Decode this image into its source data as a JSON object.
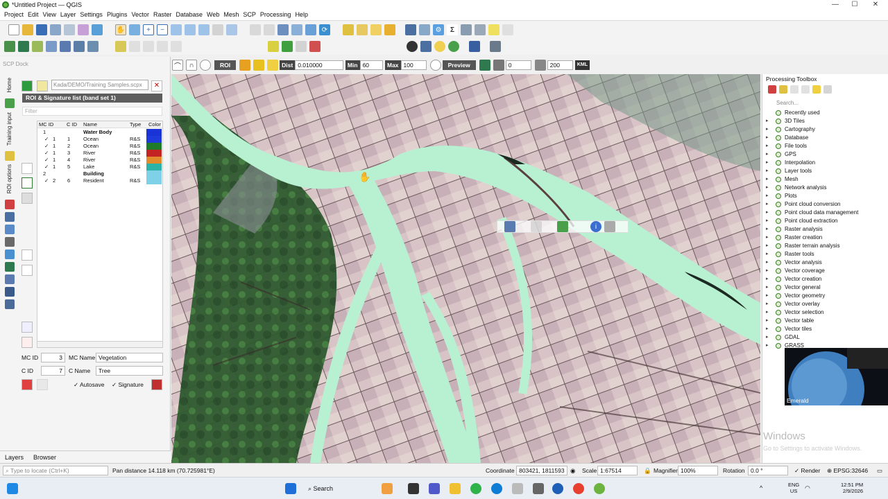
{
  "window": {
    "title": "*Untitled Project — QGIS"
  },
  "menu": [
    "Project",
    "Edit",
    "View",
    "Layer",
    "Settings",
    "Plugins",
    "Vector",
    "Raster",
    "Database",
    "Web",
    "Mesh",
    "SCP",
    "Processing",
    "Help"
  ],
  "dock": {
    "title": "SCP Dock",
    "side_tabs": [
      "Home",
      "Training input",
      "ROI options"
    ],
    "training_file": "Kada/DEMO/Training Samples.scpx",
    "roi_header": "ROI & Signature list (band set 1)",
    "filter_placeholder": "Filter",
    "columns": [
      "MC ID",
      "C ID",
      "Name",
      "Type",
      "Color"
    ],
    "rows": [
      {
        "mc": "1",
        "cid": "",
        "name": "Water Body",
        "type": "",
        "group": true,
        "color": "#1a33d6"
      },
      {
        "mc": "1",
        "cid": "1",
        "name": "Ocean",
        "type": "R&S",
        "group": false,
        "color": "#1e3adb"
      },
      {
        "mc": "1",
        "cid": "2",
        "name": "Ocean",
        "type": "R&S",
        "group": false,
        "color": "#1f7a2a"
      },
      {
        "mc": "1",
        "cid": "3",
        "name": "River",
        "type": "R&S",
        "group": false,
        "color": "#c42323"
      },
      {
        "mc": "1",
        "cid": "4",
        "name": "River",
        "type": "R&S",
        "group": false,
        "color": "#e38a2c"
      },
      {
        "mc": "1",
        "cid": "5",
        "name": "Lake",
        "type": "R&S",
        "group": false,
        "color": "#2bb3a8"
      },
      {
        "mc": "2",
        "cid": "",
        "name": "Building",
        "type": "",
        "group": true,
        "color": "#7fd1e8"
      },
      {
        "mc": "2",
        "cid": "6",
        "name": "Resident",
        "type": "R&S",
        "group": false,
        "color": "#7fd1e8"
      }
    ],
    "form": {
      "mc_id_label": "MC ID",
      "mc_id": "3",
      "mc_name_label": "MC Name",
      "mc_name": "Vegetation",
      "c_id_label": "C ID",
      "c_id": "7",
      "c_name_label": "C Name",
      "c_name": "Tree",
      "autosave_label": "Autosave",
      "signature_label": "Signature"
    },
    "bottom_tabs": [
      "Layers",
      "Browser"
    ]
  },
  "scp_toolbar": {
    "roi": "ROI",
    "dist_label": "Dist",
    "dist": "0.010000",
    "min_label": "Min",
    "min": "60",
    "max_label": "Max",
    "max": "100",
    "preview": "Preview",
    "v1": "0",
    "v2": "200",
    "kml": "KML"
  },
  "processing": {
    "title": "Processing Toolbox",
    "search_placeholder": "Search...",
    "items": [
      "Recently used",
      "3D Tiles",
      "Cartography",
      "Database",
      "File tools",
      "GPS",
      "Interpolation",
      "Layer tools",
      "Mesh",
      "Network analysis",
      "Plots",
      "Point cloud conversion",
      "Point cloud data management",
      "Point cloud extraction",
      "Raster analysis",
      "Raster creation",
      "Raster terrain analysis",
      "Raster tools",
      "Vector analysis",
      "Vector coverage",
      "Vector creation",
      "Vector general",
      "Vector geometry",
      "Vector overlay",
      "Vector selection",
      "Vector table",
      "Vector tiles",
      "GDAL",
      "GRASS"
    ]
  },
  "webcam": {
    "name": "Emerald"
  },
  "watermark": {
    "line1": "Windows",
    "line2": "Go to Settings to activate Windows."
  },
  "status": {
    "locate_placeholder": "Type to locate (Ctrl+K)",
    "message": "Pan distance 14.118 km (70.725981°E)",
    "coordinate_label": "Coordinate",
    "coordinate": "803421, 1811593",
    "scale_label": "Scale",
    "scale": "1:67514",
    "magnifier_label": "Magnifier",
    "magnifier": "100%",
    "rotation_label": "Rotation",
    "rotation": "0.0 °",
    "render_label": "Render",
    "crs": "EPSG:32646"
  },
  "taskbar": {
    "search": "Search",
    "lang1": "ENG",
    "lang2": "US",
    "time": "12:51 PM",
    "date": "2/9/2026"
  }
}
